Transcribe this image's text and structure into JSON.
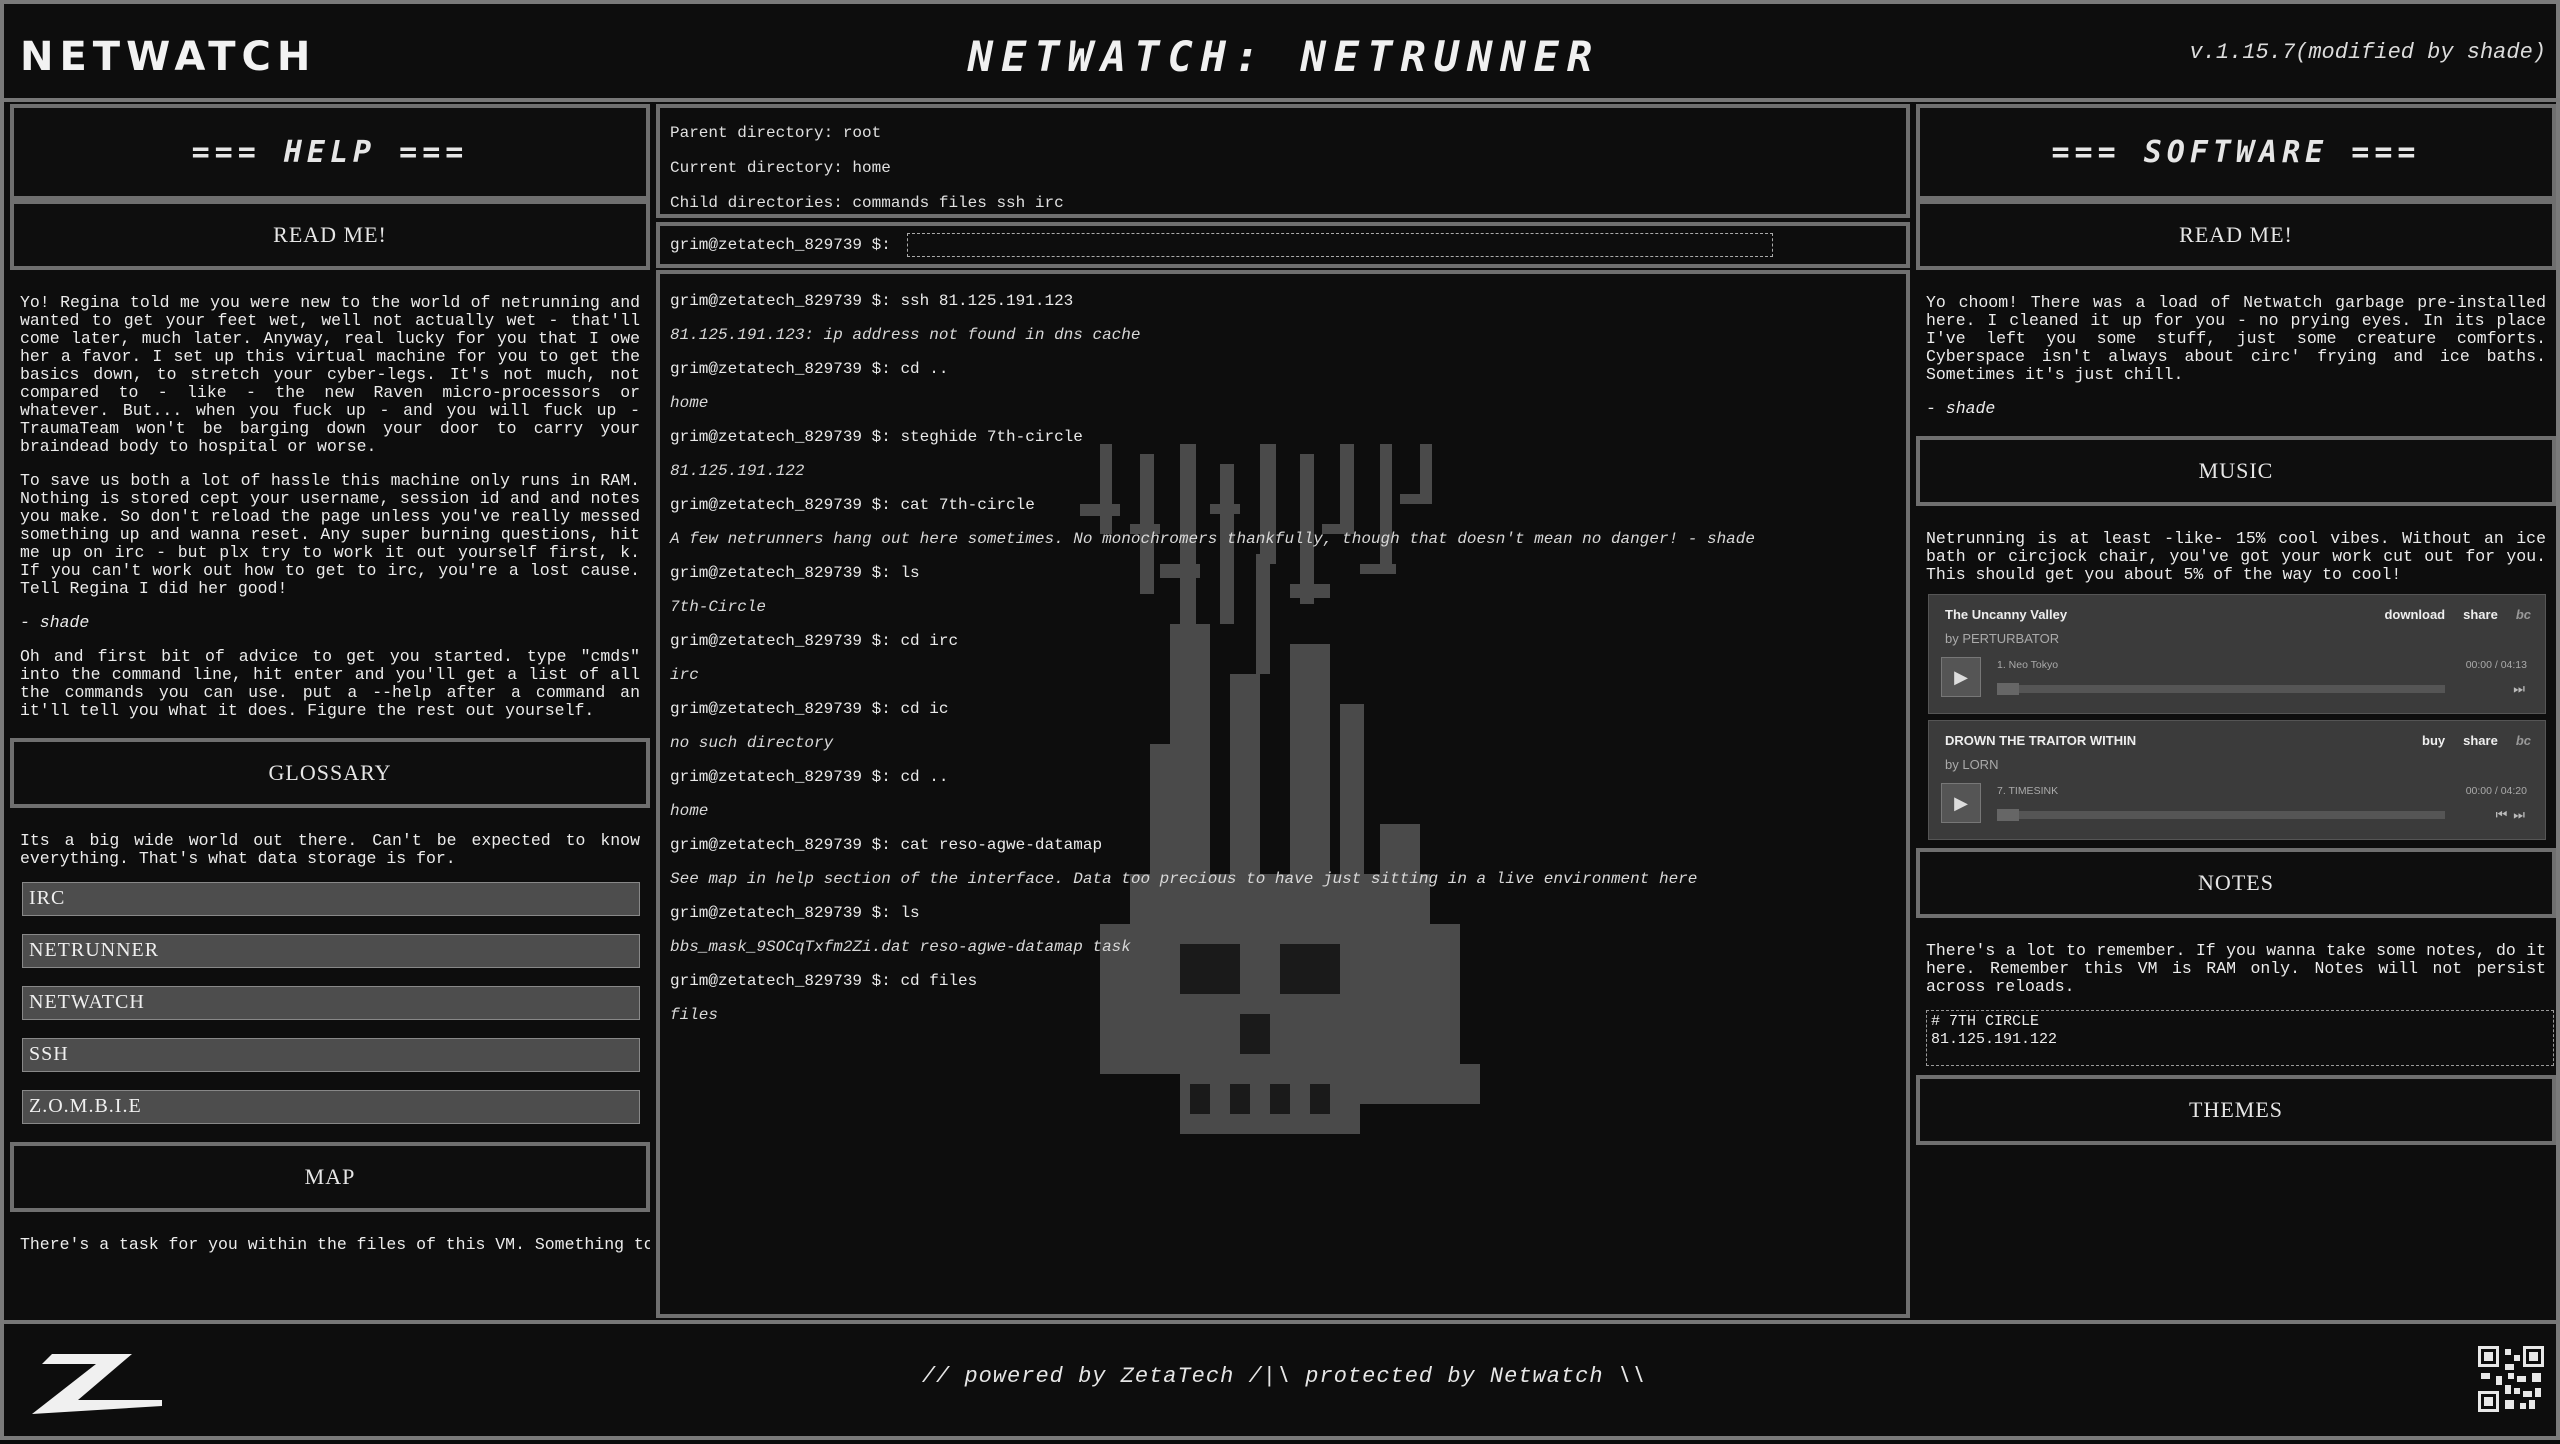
{
  "header": {
    "logo": "NETWATCH",
    "title": "NETWATCH: NETRUNNER",
    "version": "v.1.15.7(modified by shade)"
  },
  "left": {
    "help_title": "=== HELP ===",
    "readme_title": "READ ME!",
    "readme_paragraphs": [
      "Yo! Regina told me you were new to the world of netrunning and wanted to get your feet wet, well not actually wet - that'll come later, much later. Anyway, real lucky for you that I owe her a favor. I set up this virtual machine for you to get the basics down, to stretch your cyber-legs. It's not much, not compared to - like - the new Raven micro-processors or whatever. But... when you fuck up - and you will fuck up - TraumaTeam won't be barging down your door to carry your braindead body to hospital or worse.",
      "To save us both a lot of hassle this machine only runs in RAM. Nothing is stored cept your username, session id and and notes you make. So don't reload the page unless you've really messed something up and wanna reset. Any super burning questions, hit me up on irc - but plx try to work it out yourself first, k. If you can't work out how to get to irc, you're a lost cause. Tell Regina I did her good!",
      "- shade",
      "Oh and first bit of advice to get you started. type \"cmds\" into the command line, hit enter and you'll get a list of all the commands you can use. put a --help after a command an it'll tell you what it does. Figure the rest out yourself."
    ],
    "glossary_title": "GLOSSARY",
    "glossary_text": "Its a big wide world out there. Can't be expected to know everything. That's what data storage is for.",
    "glossary_items": [
      "IRC",
      "NETRUNNER",
      "NETWATCH",
      "SSH",
      "Z.O.M.B.I.E"
    ],
    "map_title": "MAP",
    "map_text": "There's a task for you within the files of this VM. Something to"
  },
  "center": {
    "parent_dir": "Parent directory: root",
    "current_dir": "Current directory: home",
    "child_dirs": "Child directories: commands files ssh irc",
    "prompt": "grim@zetatech_829739 $:",
    "input_value": "",
    "terminal": [
      {
        "text": "grim@zetatech_829739 $: ssh 81.125.191.123",
        "kind": "cmd"
      },
      {
        "text": "81.125.191.123: ip address not found in dns cache",
        "kind": "out"
      },
      {
        "text": "grim@zetatech_829739 $: cd ..",
        "kind": "cmd"
      },
      {
        "text": "home",
        "kind": "out"
      },
      {
        "text": "grim@zetatech_829739 $: steghide 7th-circle",
        "kind": "cmd"
      },
      {
        "text": "81.125.191.122",
        "kind": "out"
      },
      {
        "text": "grim@zetatech_829739 $: cat 7th-circle",
        "kind": "cmd"
      },
      {
        "text": "A few netrunners hang out here sometimes. No monochromers thankfully, though that doesn't mean no danger! - shade",
        "kind": "out"
      },
      {
        "text": "grim@zetatech_829739 $: ls",
        "kind": "cmd"
      },
      {
        "text": "7th-Circle",
        "kind": "out"
      },
      {
        "text": "grim@zetatech_829739 $: cd irc",
        "kind": "cmd"
      },
      {
        "text": "irc",
        "kind": "out"
      },
      {
        "text": "grim@zetatech_829739 $: cd ic",
        "kind": "cmd"
      },
      {
        "text": "no such directory",
        "kind": "out"
      },
      {
        "text": "grim@zetatech_829739 $: cd ..",
        "kind": "cmd"
      },
      {
        "text": "home",
        "kind": "out"
      },
      {
        "text": "grim@zetatech_829739 $: cat reso-agwe-datamap",
        "kind": "cmd"
      },
      {
        "text": "See map in help section of the interface. Data too precious to have just sitting in a live environment here",
        "kind": "out"
      },
      {
        "text": "grim@zetatech_829739 $: ls",
        "kind": "cmd"
      },
      {
        "text": "bbs_mask_9SOCqTxfm2Zi.dat reso-agwe-datamap task",
        "kind": "out"
      },
      {
        "text": "grim@zetatech_829739 $: cd files",
        "kind": "cmd"
      },
      {
        "text": "files",
        "kind": "out"
      }
    ]
  },
  "right": {
    "software_title": "=== SOFTWARE ===",
    "readme_title": "READ ME!",
    "readme_text": "Yo choom! There was a load of Netwatch garbage pre-installed here. I cleaned it up for you - no prying eyes. In its place I've left you some stuff, just some creature comforts. Cyberspace isn't always about circ' frying and ice baths. Sometimes it's just chill.",
    "readme_sign": "- shade",
    "music_title": "MUSIC",
    "music_text": "Netrunning is at least -like- 15% cool vibes. Without an ice bath or circjock chair, you've got your work cut out for you. This should get you about 5% of the way to cool!",
    "players": [
      {
        "title": "The Uncanny Valley",
        "artist": "by PERTURBATOR",
        "action1": "download",
        "action2": "share",
        "bc": "bc",
        "track": "1.  Neo Tokyo",
        "time": "00:00 / 04:13",
        "progress": 0
      },
      {
        "title": "DROWN THE TRAITOR WITHIN",
        "artist": "by LORN",
        "action1": "buy",
        "action2": "share",
        "bc": "bc",
        "track": "7.  TIMESINK",
        "time": "00:00 / 04:20",
        "progress": 0
      }
    ],
    "notes_title": "NOTES",
    "notes_text": "There's a lot to remember. If you wanna take some notes, do it here. Remember this VM is RAM only. Notes will not persist across reloads.",
    "notes_value": "# 7TH CIRCLE\n81.125.191.122",
    "themes_title": "THEMES"
  },
  "footer": {
    "text": "// powered by ZetaTech /|\\ protected by Netwatch \\\\"
  }
}
